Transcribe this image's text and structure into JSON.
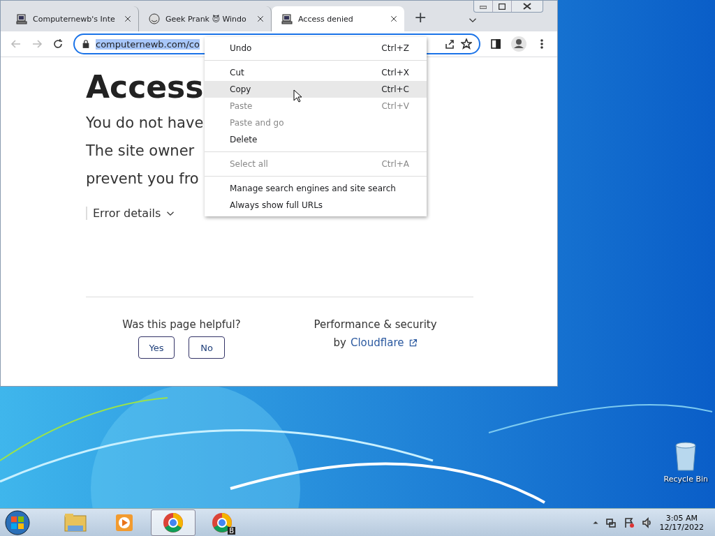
{
  "browser": {
    "tabs": [
      {
        "title": "Computernewb's Inte",
        "selected": false
      },
      {
        "title": "Geek Prank 😈 Windo",
        "selected": false
      },
      {
        "title": "Access denied",
        "selected": true
      }
    ],
    "new_tab": "+",
    "address": {
      "value": "computernewb.com/co",
      "selected_text": true
    }
  },
  "page": {
    "heading": "Access",
    "lines": [
      "You do not have",
      "The site owner",
      "prevent you fro"
    ],
    "error_details": "Error details",
    "feedback": {
      "question": "Was this page helpful?",
      "buttons": [
        "Yes",
        "No"
      ]
    },
    "footer": {
      "line1": "Performance & security",
      "by": "by",
      "link": "Cloudflare"
    }
  },
  "context_menu": [
    {
      "kind": "item",
      "label": "Undo",
      "shortcut": "Ctrl+Z",
      "disabled": false,
      "selected": false
    },
    {
      "kind": "separator"
    },
    {
      "kind": "item",
      "label": "Cut",
      "shortcut": "Ctrl+X",
      "disabled": false,
      "selected": false
    },
    {
      "kind": "item",
      "label": "Copy",
      "shortcut": "Ctrl+C",
      "disabled": false,
      "selected": true
    },
    {
      "kind": "item",
      "label": "Paste",
      "shortcut": "Ctrl+V",
      "disabled": true,
      "selected": false
    },
    {
      "kind": "item",
      "label": "Paste and go",
      "disabled": true,
      "selected": false
    },
    {
      "kind": "item",
      "label": "Delete",
      "disabled": false,
      "selected": false
    },
    {
      "kind": "separator"
    },
    {
      "kind": "item",
      "label": "Select all",
      "shortcut": "Ctrl+A",
      "disabled": true,
      "selected": false
    },
    {
      "kind": "separator"
    },
    {
      "kind": "item",
      "label": "Manage search engines and site search",
      "disabled": false,
      "selected": false
    },
    {
      "kind": "item",
      "label": "Always show full URLs",
      "disabled": false,
      "selected": false
    }
  ],
  "desktop": {
    "icons": [
      {
        "label": "Recycle Bin"
      }
    ]
  },
  "taskbar": {
    "apps": [
      {
        "kind": "folder",
        "selected": false
      },
      {
        "kind": "media",
        "selected": false
      },
      {
        "kind": "chrome",
        "selected": true
      },
      {
        "kind": "chrome-badge",
        "badge": "B",
        "selected": false
      }
    ],
    "time": "3:05 AM",
    "date": "12/17/2022"
  }
}
